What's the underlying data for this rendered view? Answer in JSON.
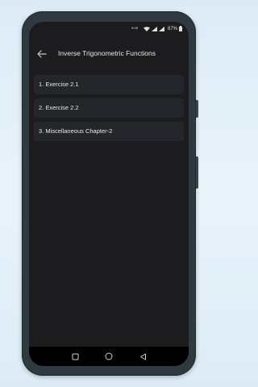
{
  "status": {
    "time": "5:28",
    "battery": "87%"
  },
  "appbar": {
    "title": "Inverse Trigonometric Functions",
    "back_icon": "arrow-left-icon"
  },
  "items": [
    {
      "label": "1. Exercise 2.1"
    },
    {
      "label": "2. Exercise 2.2"
    },
    {
      "label": "3. Miscellaneous Chapter-2"
    }
  ],
  "nav": {
    "recent_icon": "square-icon",
    "home_icon": "circle-icon",
    "back_icon": "triangle-back-icon"
  },
  "colors": {
    "background": "#1c1c1f",
    "item_bg": "#23262b",
    "page_bg": "#dcecf7"
  }
}
